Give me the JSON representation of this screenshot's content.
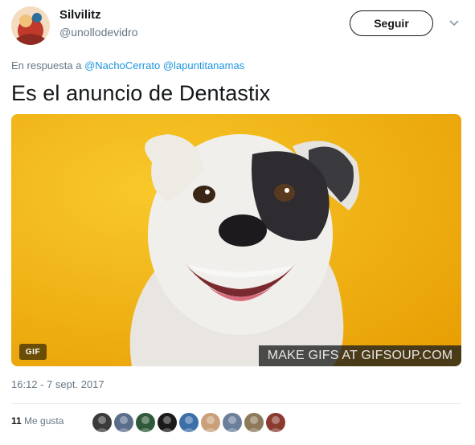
{
  "author": {
    "display_name": "Silvilitz",
    "handle": "@unollodevidro"
  },
  "follow_button": {
    "label": "Seguir"
  },
  "reply_context": {
    "prefix": "En respuesta a",
    "mentions": [
      "@NachoCerrato",
      "@lapuntitanamas"
    ]
  },
  "tweet": {
    "text": "Es el anuncio de Dentastix"
  },
  "media": {
    "badge": "GIF",
    "watermark": "MAKE GIFS AT GIFSOUP.COM",
    "background_color": "#f3b30e"
  },
  "timestamp": "16:12 - 7 sept. 2017",
  "likes": {
    "count": "11",
    "label": "Me gusta",
    "liker_avatar_colors": [
      "#3b3b3b",
      "#5a6e8c",
      "#2f5a3a",
      "#1a1a1a",
      "#3c6fa8",
      "#c9a07a",
      "#6b7f9a",
      "#8c7a5a",
      "#8a3b2e"
    ]
  },
  "colors": {
    "link": "#1b95e0",
    "secondary_text": "#657786",
    "primary_text": "#14171a"
  }
}
